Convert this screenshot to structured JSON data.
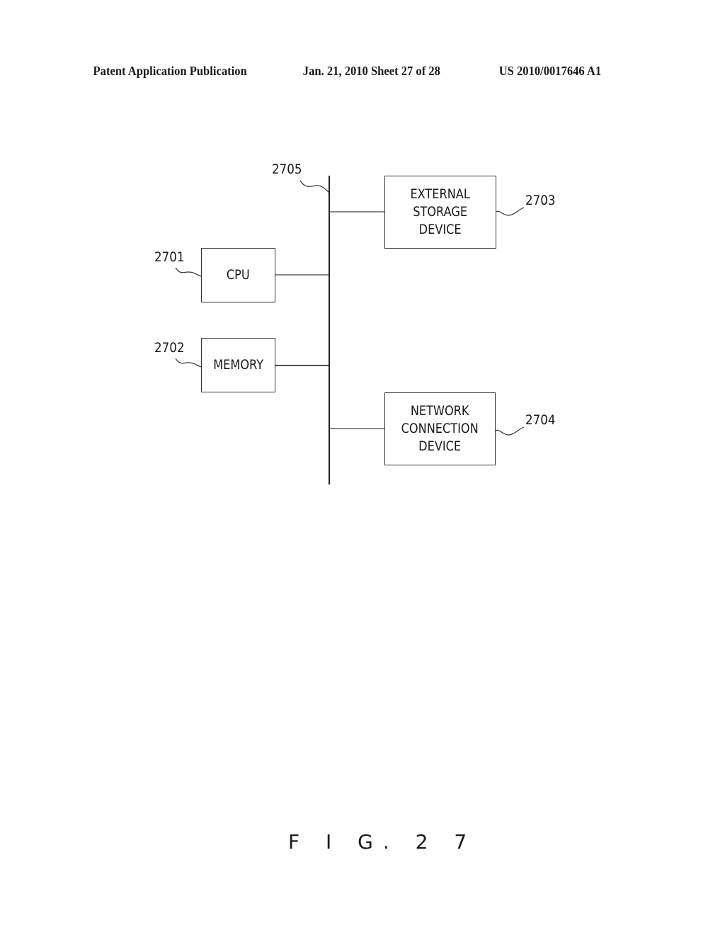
{
  "header": {
    "publication": "Patent Application Publication",
    "date_sheet": "Jan. 21, 2010  Sheet 27 of 28",
    "patent_number": "US 2010/0017646 A1"
  },
  "diagram": {
    "bus": {
      "ref": "2705"
    },
    "nodes": [
      {
        "id": "cpu",
        "label": "CPU",
        "ref": "2701"
      },
      {
        "id": "memory",
        "label": "MEMORY",
        "ref": "2702"
      },
      {
        "id": "external-storage",
        "label": "EXTERNAL\nSTORAGE\nDEVICE",
        "ref": "2703"
      },
      {
        "id": "network-connection",
        "label": "NETWORK\nCONNECTION\nDEVICE",
        "ref": "2704"
      }
    ],
    "edges": [
      {
        "from": "cpu",
        "to": "bus"
      },
      {
        "from": "memory",
        "to": "bus"
      },
      {
        "from": "external-storage",
        "to": "bus"
      },
      {
        "from": "network-connection",
        "to": "bus"
      }
    ]
  },
  "figure_label": "F I G. 2 7"
}
